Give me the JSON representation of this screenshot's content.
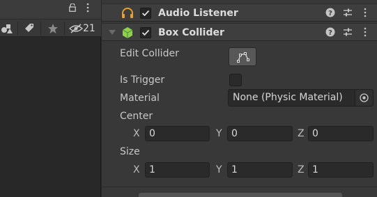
{
  "project_panel": {
    "hidden_count": "21"
  },
  "components": {
    "audio_listener": {
      "title": "Audio Listener",
      "enabled": true
    },
    "box_collider": {
      "title": "Box Collider",
      "enabled": true,
      "edit_collider_label": "Edit Collider",
      "is_trigger_label": "Is Trigger",
      "is_trigger_value": false,
      "material_label": "Material",
      "material_value": "None (Physic Material)",
      "center_label": "Center",
      "center": {
        "x_label": "X",
        "x": "0",
        "y_label": "Y",
        "y": "0",
        "z_label": "Z",
        "z": "0"
      },
      "size_label": "Size",
      "size": {
        "x_label": "X",
        "x": "1",
        "y_label": "Y",
        "y": "1",
        "z_label": "Z",
        "z": "1"
      }
    }
  },
  "colors": {
    "inspector_bg": "#383838",
    "header_bg": "#3e3e3e",
    "field_bg": "#2a2a2a",
    "audio_icon": "#e8a02a",
    "collider_icon": "#8fd14f"
  }
}
